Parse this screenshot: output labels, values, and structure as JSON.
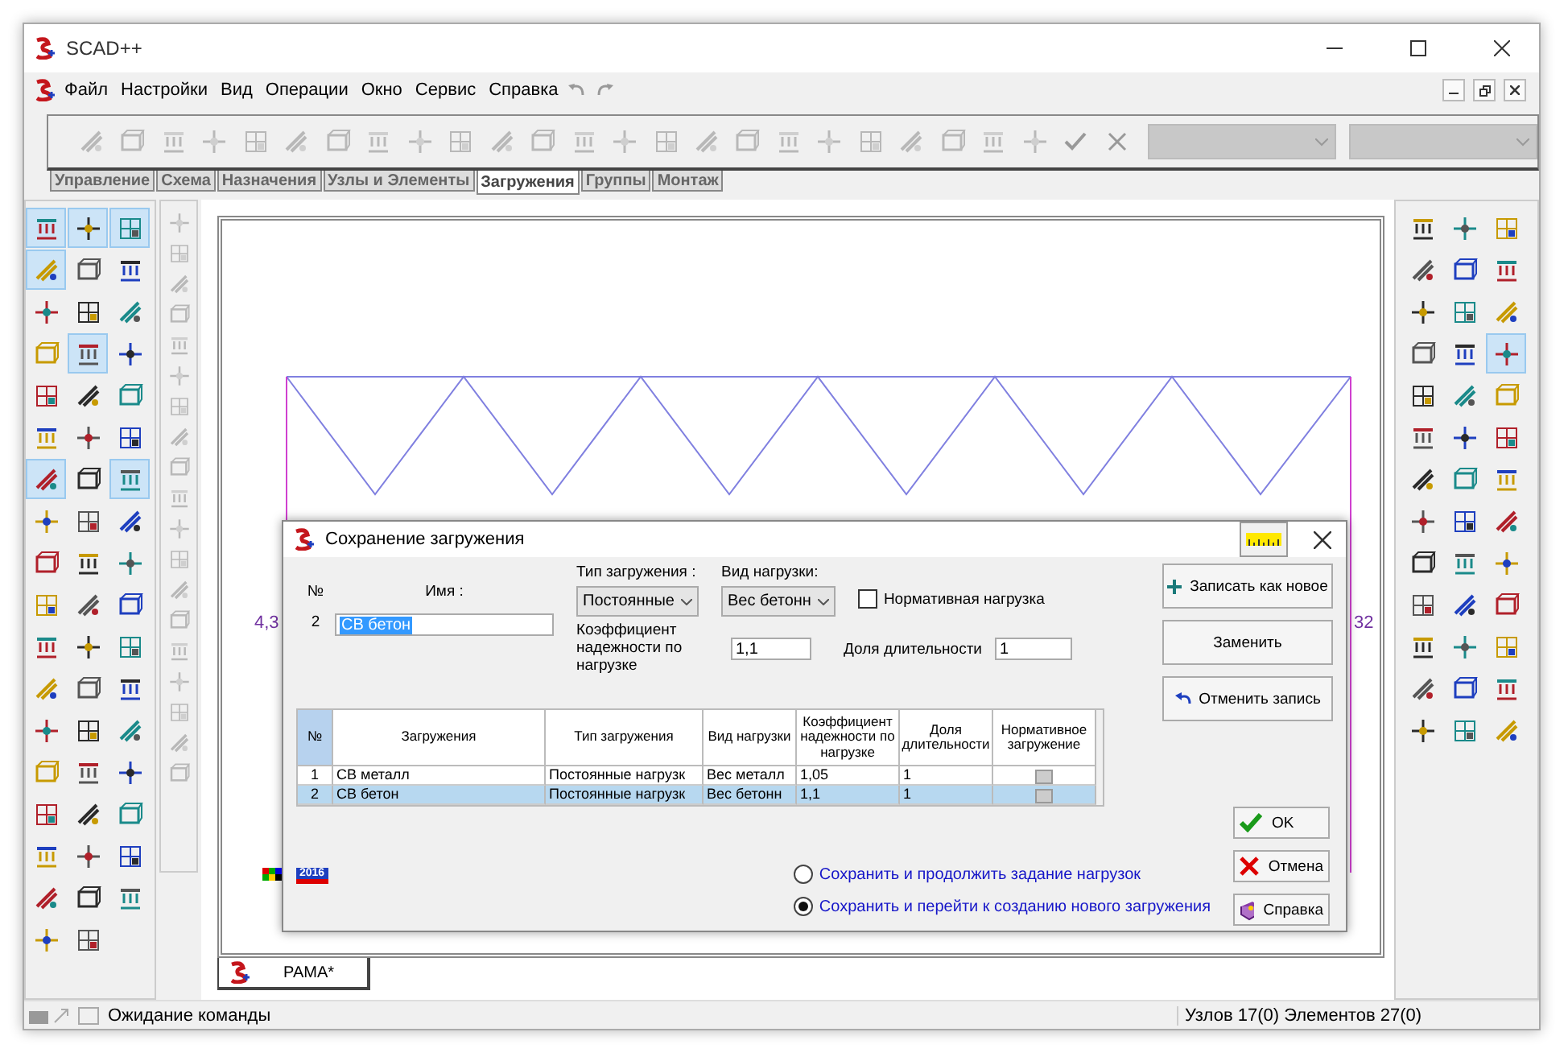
{
  "window": {
    "title": "SCAD++"
  },
  "menu": [
    "Файл",
    "Настройки",
    "Вид",
    "Операции",
    "Окно",
    "Сервис",
    "Справка"
  ],
  "tabs": [
    {
      "label": "Управление",
      "selected": false
    },
    {
      "label": "Схема",
      "selected": false
    },
    {
      "label": "Назначения",
      "selected": false
    },
    {
      "label": "Узлы и Элементы",
      "selected": false
    },
    {
      "label": "Загружения",
      "selected": true
    },
    {
      "label": "Группы",
      "selected": false
    },
    {
      "label": "Монтаж",
      "selected": false
    }
  ],
  "left_palette": [
    {
      "pressed": true
    },
    {
      "pressed": true
    },
    {
      "pressed": true
    },
    {
      "pressed": true
    },
    {
      "pressed": false
    },
    {
      "pressed": false
    },
    {
      "pressed": false
    },
    {
      "pressed": false
    },
    {
      "pressed": false
    },
    {
      "pressed": false
    },
    {
      "pressed": true
    },
    {
      "pressed": false
    },
    {
      "pressed": false
    },
    {
      "pressed": false
    },
    {
      "pressed": false
    },
    {
      "pressed": false
    },
    {
      "pressed": false
    },
    {
      "pressed": false
    },
    {
      "pressed": true
    },
    {
      "pressed": false
    },
    {
      "pressed": true
    },
    {
      "pressed": false
    },
    {
      "pressed": false
    },
    {
      "pressed": false
    },
    {
      "pressed": false
    },
    {
      "pressed": false
    },
    {
      "pressed": false
    },
    {
      "pressed": false
    },
    {
      "pressed": false
    },
    {
      "pressed": false
    },
    {
      "pressed": false
    },
    {
      "pressed": false
    },
    {
      "pressed": false
    },
    {
      "pressed": false
    },
    {
      "pressed": false
    },
    {
      "pressed": false
    },
    {
      "pressed": false
    },
    {
      "pressed": false
    },
    {
      "pressed": false
    },
    {
      "pressed": false
    },
    {
      "pressed": false
    },
    {
      "pressed": false
    },
    {
      "pressed": false
    },
    {
      "pressed": false
    },
    {
      "pressed": false
    },
    {
      "pressed": false
    },
    {
      "pressed": false
    },
    {
      "pressed": false
    },
    {
      "pressed": false
    },
    {
      "pressed": false
    },
    {
      "pressed": false
    },
    {
      "pressed": false
    },
    {
      "pressed": false
    }
  ],
  "right_palette": [
    {
      "pressed": false
    },
    {
      "pressed": false
    },
    {
      "pressed": false
    },
    {
      "pressed": false
    },
    {
      "pressed": false
    },
    {
      "pressed": false
    },
    {
      "pressed": false
    },
    {
      "pressed": false
    },
    {
      "pressed": false
    },
    {
      "pressed": false
    },
    {
      "pressed": false
    },
    {
      "pressed": true
    },
    {
      "pressed": false
    },
    {
      "pressed": false
    },
    {
      "pressed": false
    },
    {
      "pressed": false
    },
    {
      "pressed": false
    },
    {
      "pressed": false
    },
    {
      "pressed": false
    },
    {
      "pressed": false
    },
    {
      "pressed": false
    },
    {
      "pressed": false
    },
    {
      "pressed": false
    },
    {
      "pressed": false
    },
    {
      "pressed": false
    },
    {
      "pressed": false
    },
    {
      "pressed": false
    },
    {
      "pressed": false
    },
    {
      "pressed": false
    },
    {
      "pressed": false
    },
    {
      "pressed": false
    },
    {
      "pressed": false
    },
    {
      "pressed": false
    },
    {
      "pressed": false
    },
    {
      "pressed": false
    },
    {
      "pressed": false
    },
    {
      "pressed": false
    },
    {
      "pressed": false
    },
    {
      "pressed": false
    }
  ],
  "canvas": {
    "left_label": "4,3",
    "right_label": "32",
    "badge": "2016"
  },
  "document_tabs": [
    {
      "label": "РАМА*",
      "selected": true
    }
  ],
  "dialog": {
    "title": "Сохранение загружения",
    "number_label": "№",
    "number": "2",
    "name_label": "Имя :",
    "name_value": "СВ бетон",
    "load_type_label": "Тип загружения :",
    "load_type": "Постоянные",
    "load_kind_label": "Вид нагрузки:",
    "load_kind": "Вес бетонн",
    "normative": {
      "label": "Нормативная нагрузка",
      "checked": false
    },
    "factor_label": "Коэффициент надежности по нагрузке",
    "factor": "1,1",
    "duration_label": "Доля длительности",
    "duration": "1",
    "table": {
      "columns": [
        "№",
        "Загружения",
        "Тип загружения",
        "Вид нагрузки",
        "Коэффициент надежности по нагрузке",
        "Доля длительности",
        "Нормативное загружение"
      ],
      "rows": [
        {
          "cells": [
            "1",
            "СВ металл",
            "Постоянные нагрузк",
            "Вес металл",
            "1,05",
            "1"
          ],
          "normative": false,
          "selected": false
        },
        {
          "cells": [
            "2",
            "СВ бетон",
            "Постоянные нагрузк",
            "Вес бетонн",
            "1,1",
            "1"
          ],
          "normative": false,
          "selected": true
        }
      ]
    },
    "side_buttons": [
      {
        "label": "Записать как новое",
        "kind": "add"
      },
      {
        "label": "Заменить",
        "kind": "plain"
      },
      {
        "label": "Отменить запись",
        "kind": "undo"
      }
    ],
    "options": [
      {
        "label": "Сохранить и продолжить задание нагрузок",
        "selected": false
      },
      {
        "label": "Сохранить и перейти к созданию нового загружения",
        "selected": true
      }
    ],
    "actions": [
      {
        "label": "OK",
        "kind": "ok"
      },
      {
        "label": "Отмена",
        "kind": "cancel"
      },
      {
        "label": "Справка",
        "kind": "help"
      }
    ]
  },
  "status_bar": {
    "message": "Ожидание команды",
    "counts": "Узлов 17(0) Элементов 27(0)"
  }
}
